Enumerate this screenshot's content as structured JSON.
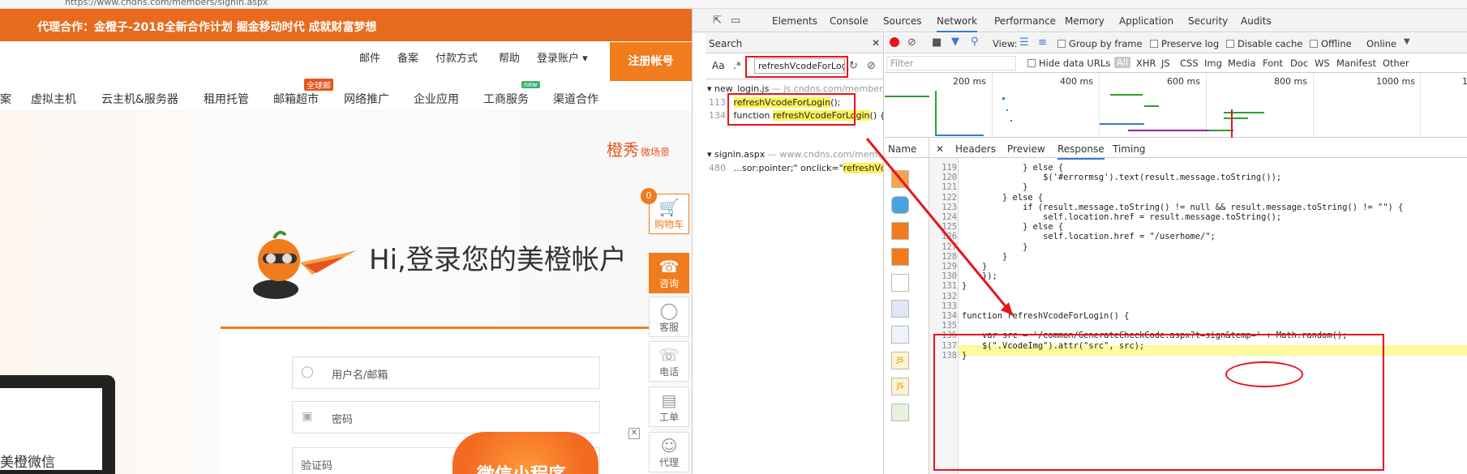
{
  "browser": {
    "address_text": "https://www.cndns.com/members/signin.aspx"
  },
  "site": {
    "promo": "代理合作：金橙子-2018全新合作计划 掘金移动时代 成就财富梦想",
    "toplinks": [
      "邮件",
      "备案",
      "付款方式",
      "帮助",
      "登录账户 ▾"
    ],
    "register_label": "注册帐号",
    "nav": [
      "案",
      "虚拟主机",
      "云主机&服务器",
      "租用托管",
      "邮箱超市",
      "网络推广",
      "企业应用",
      "工商服务",
      "渠道合作"
    ],
    "nav_badges": {
      "mailbox": "全球邮",
      "business": "new"
    },
    "brand_logo": "橙秀",
    "brand_sub": "微场景",
    "greeting": "Hi,登录您的美橙帐户",
    "username_placeholder": "用户名/邮箱",
    "password_placeholder": "密码",
    "captcha_placeholder": "验证码",
    "wechat_text": "美橙微信",
    "miniprogram_text": "微信小程序",
    "close_label": "✕",
    "side": {
      "cart_count": "0",
      "cart": "购物车",
      "consult": "咨询",
      "service": "客服",
      "phone": "电话",
      "ticket": "工单",
      "agent": "代理"
    }
  },
  "devtools": {
    "tabs": [
      "Elements",
      "Console",
      "Sources",
      "Network",
      "Performance",
      "Memory",
      "Application",
      "Security",
      "Audits"
    ],
    "active_tab": "Network",
    "search": {
      "title": "Search",
      "close": "✕",
      "aa": "Aa",
      "regex": ".*",
      "query": "refreshVcodeForLog",
      "results": [
        {
          "file": "new_login.js",
          "source": "— js.cndns.com/member...",
          "lines": [
            {
              "num": "113",
              "pre": "",
              "match": "refreshVcodeForLogin",
              "post": "();"
            },
            {
              "num": "134",
              "pre": "function ",
              "match": "refreshVcodeForLogin",
              "post": "() {"
            }
          ]
        },
        {
          "file": "signin.aspx",
          "source": "— www.cndns.com/mem...",
          "lines": [
            {
              "num": "480",
              "pre": "...sor:pointer;\" onclick=\"",
              "match": "refreshVc...",
              "post": ""
            }
          ]
        }
      ]
    },
    "network": {
      "view_label": "View:",
      "group_by_frame": "Group by frame",
      "preserve_log": "Preserve log",
      "disable_cache": "Disable cache",
      "offline": "Offline",
      "online": "Online",
      "filter_placeholder": "Filter",
      "hide_data_urls": "Hide data URLs",
      "types": [
        "All",
        "XHR",
        "JS",
        "CSS",
        "Img",
        "Media",
        "Font",
        "Doc",
        "WS",
        "Manifest",
        "Other"
      ],
      "ticks": [
        "200 ms",
        "400 ms",
        "600 ms",
        "800 ms",
        "1000 ms",
        "1"
      ],
      "name_header": "Name",
      "detail_tabs": [
        "✕",
        "Headers",
        "Preview",
        "Response",
        "Timing"
      ],
      "active_detail": "Response"
    },
    "code": [
      {
        "n": "119",
        "t": "            } else {"
      },
      {
        "n": "120",
        "t": "                $('#errormsg').text(result.message.toString());"
      },
      {
        "n": "121",
        "t": "            }"
      },
      {
        "n": "122",
        "t": "        } else {"
      },
      {
        "n": "123",
        "t": "            if (result.message.toString() != null && result.message.toString() != \"\") {"
      },
      {
        "n": "124",
        "t": "                self.location.href = result.message.toString();"
      },
      {
        "n": "125",
        "t": "            } else {"
      },
      {
        "n": "126",
        "t": "                self.location.href = \"/userhome/\";"
      },
      {
        "n": "127",
        "t": "            }"
      },
      {
        "n": "128",
        "t": "        }"
      },
      {
        "n": "129",
        "t": "    }"
      },
      {
        "n": "130",
        "t": "    });"
      },
      {
        "n": "131",
        "t": "}"
      },
      {
        "n": "132",
        "t": ""
      },
      {
        "n": "133",
        "t": ""
      },
      {
        "n": "134",
        "t": "function refreshVcodeForLogin() {"
      },
      {
        "n": "135",
        "t": ""
      },
      {
        "n": "136",
        "t": "    var src = '/common/GenerateCheckCode.aspx?t=sign&temp=' + Math.random();"
      },
      {
        "n": "137",
        "t": "    $(\".VcodeImg\").attr(\"src\", src);"
      },
      {
        "n": "138",
        "t": "}"
      }
    ]
  },
  "colors": {
    "accent": "#f07c1e",
    "promo": "#e86b1d",
    "annotation": "#e8141b",
    "highlight": "#fff35a"
  }
}
